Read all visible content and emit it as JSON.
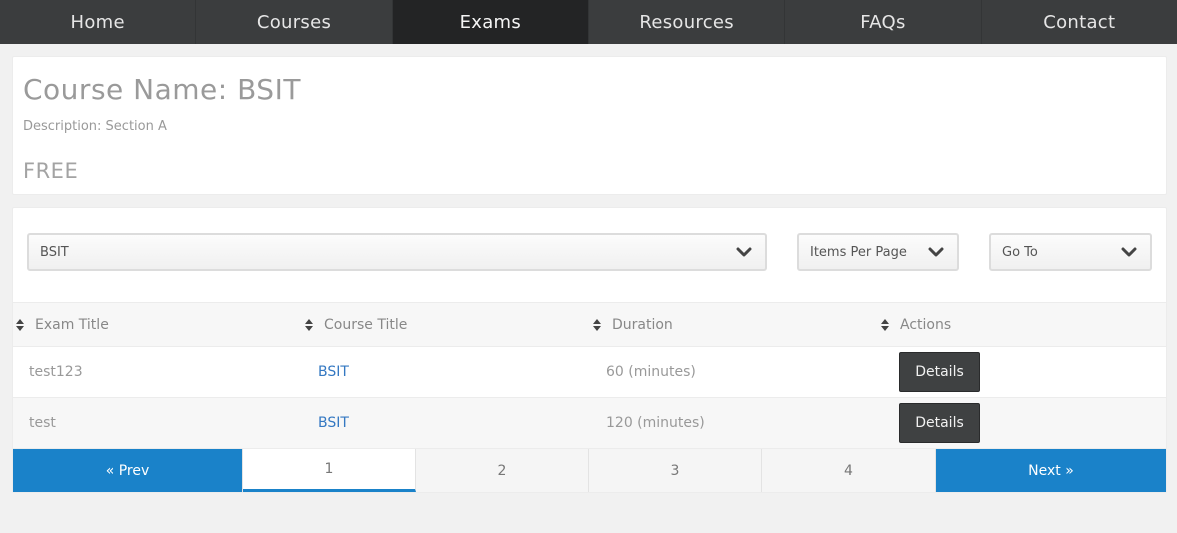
{
  "nav": {
    "items": [
      {
        "label": "Home"
      },
      {
        "label": "Courses"
      },
      {
        "label": "Exams"
      },
      {
        "label": "Resources"
      },
      {
        "label": "FAQs"
      },
      {
        "label": "Contact"
      }
    ],
    "active": "Exams"
  },
  "course": {
    "title": "Course Name: BSIT",
    "description": "Description: Section A",
    "price": "FREE"
  },
  "filters": {
    "course_select": "BSIT",
    "items_per_page": "Items Per Page",
    "go_to": "Go To"
  },
  "table": {
    "headers": [
      "Exam Title",
      "Course Title",
      "Duration",
      "Actions"
    ],
    "rows": [
      {
        "exam_title": "test123",
        "course_title": "BSIT",
        "duration": "60 (minutes)",
        "action": "Details"
      },
      {
        "exam_title": "test",
        "course_title": "BSIT",
        "duration": "120 (minutes)",
        "action": "Details"
      }
    ]
  },
  "pagination": {
    "prev": "« Prev",
    "next": "Next »",
    "pages": [
      "1",
      "2",
      "3",
      "4"
    ],
    "current": "1"
  },
  "colors": {
    "nav_bg": "#3b3d3e",
    "nav_active": "#232425",
    "accent": "#1a82c9",
    "link": "#3478c2",
    "button": "#3f4142"
  },
  "icons": {
    "select_arrow": "chevron-down-icon",
    "sort": "sort-icon"
  }
}
